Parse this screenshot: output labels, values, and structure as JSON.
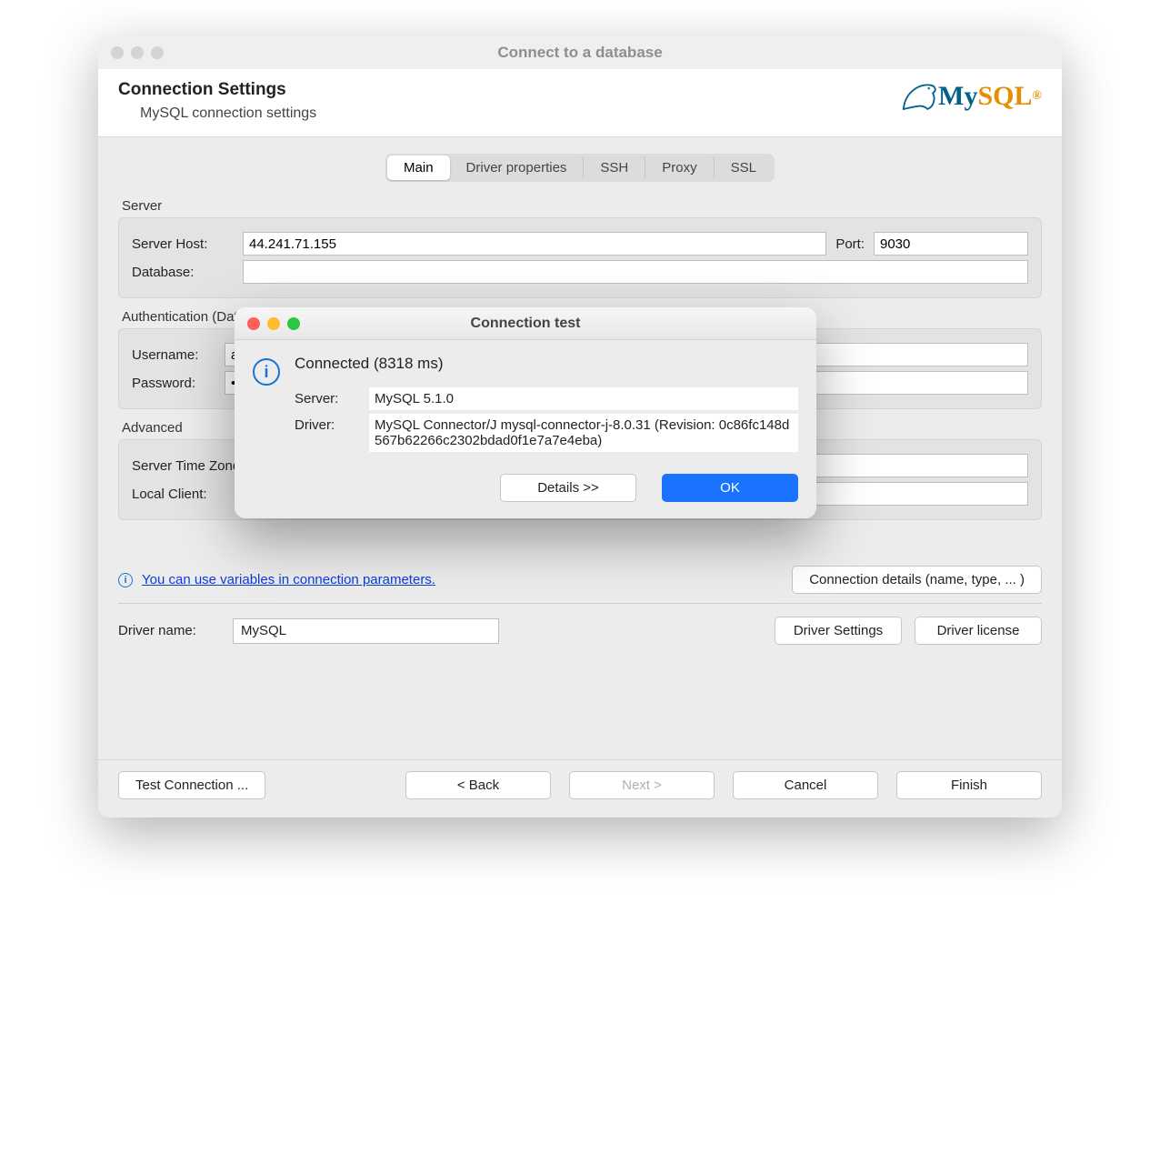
{
  "window": {
    "title": "Connect to a database"
  },
  "header": {
    "title": "Connection Settings",
    "subtitle": "MySQL connection settings",
    "logo_text_my": "My",
    "logo_text_sql": "SQL",
    "logo_r": "®"
  },
  "tabs": [
    "Main",
    "Driver properties",
    "SSH",
    "Proxy",
    "SSL"
  ],
  "active_tab": 0,
  "server": {
    "section": "Server",
    "host_label": "Server Host:",
    "host_value": "44.241.71.155",
    "port_label": "Port:",
    "port_value": "9030",
    "database_label": "Database:",
    "database_value": ""
  },
  "auth": {
    "section": "Authentication (Database Native)",
    "username_label": "Username:",
    "username_value": "adm",
    "password_label": "Password:",
    "password_value": "••••"
  },
  "advanced": {
    "section": "Advanced",
    "tz_label": "Server Time Zone",
    "tz_value": "",
    "local_client_label": "Local Client:",
    "local_client_value": ""
  },
  "hint": {
    "text": "You can use variables in connection parameters.",
    "connection_details_btn": "Connection details (name, type, ... )"
  },
  "driver": {
    "name_label": "Driver name:",
    "name_value": "MySQL",
    "settings_btn": "Driver Settings",
    "license_btn": "Driver license"
  },
  "footer": {
    "test": "Test Connection ...",
    "back": "< Back",
    "next": "Next >",
    "cancel": "Cancel",
    "finish": "Finish"
  },
  "modal": {
    "title": "Connection test",
    "message": "Connected (8318 ms)",
    "server_label": "Server:",
    "server_value": "MySQL 5.1.0",
    "driver_label": "Driver:",
    "driver_value": "MySQL Connector/J mysql-connector-j-8.0.31 (Revision: 0c86fc148d567b62266c2302bdad0f1e7a7e4eba)",
    "details_btn": "Details >>",
    "ok_btn": "OK"
  }
}
